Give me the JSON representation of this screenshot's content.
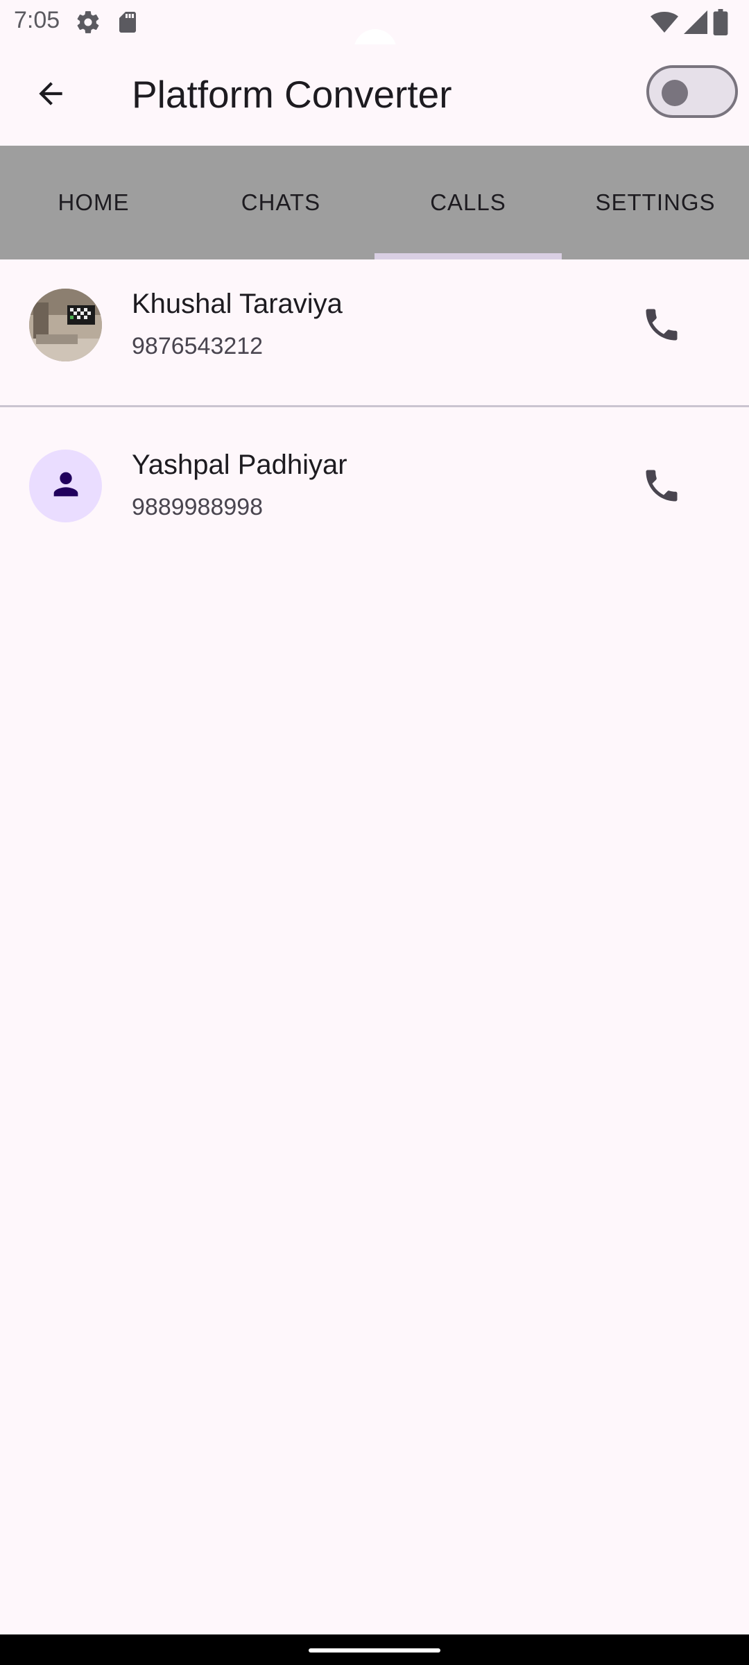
{
  "status_bar": {
    "time": "7:05",
    "left_icons": [
      "gear-icon",
      "sd-card-icon"
    ],
    "right_icons": [
      "wifi-icon",
      "signal-icon",
      "battery-icon"
    ]
  },
  "app_bar": {
    "back_icon": "arrow-left-icon",
    "title": "Platform Converter",
    "toggle_on": false
  },
  "tabs": [
    {
      "label": "HOME",
      "selected": false
    },
    {
      "label": "CHATS",
      "selected": false
    },
    {
      "label": "CALLS",
      "selected": true
    },
    {
      "label": "SETTINGS",
      "selected": false
    }
  ],
  "calls": [
    {
      "name": "Khushal Taraviya",
      "phone": "9876543212",
      "avatar": "photo",
      "action_icon": "phone-icon"
    },
    {
      "name": "Yashpal Padhiyar",
      "phone": "9889988998",
      "avatar": "person-icon",
      "action_icon": "phone-icon"
    }
  ],
  "colors": {
    "background": "#fef7fb",
    "tab_bar": "#9e9e9e",
    "tab_indicator": "#d9cfe3",
    "avatar_default_bg": "#eaddff",
    "avatar_default_icon": "#21005d"
  }
}
